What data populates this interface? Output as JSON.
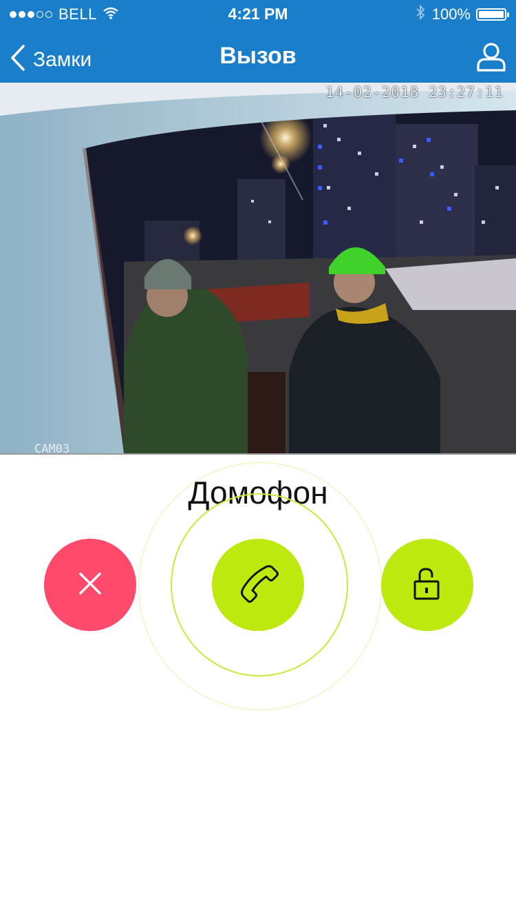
{
  "status_bar": {
    "carrier": "BELL",
    "time": "4:21 PM",
    "battery": "100%",
    "battery_level": 1.0,
    "signal_bars": 3,
    "signal_total": 5
  },
  "nav": {
    "back_label": "Замки",
    "title": "Вызов"
  },
  "video": {
    "timestamp": "14-02-2018 23:27:11",
    "camera_label": "CAM03"
  },
  "call": {
    "title": "Домофон"
  },
  "colors": {
    "brand_blue": "#1a7fca",
    "decline_red": "#ff4a6b",
    "accent_green": "#bde90f"
  },
  "icons": {
    "back": "chevron-left-icon",
    "user": "user-icon",
    "decline": "close-icon",
    "answer": "phone-icon",
    "unlock": "unlock-icon"
  }
}
